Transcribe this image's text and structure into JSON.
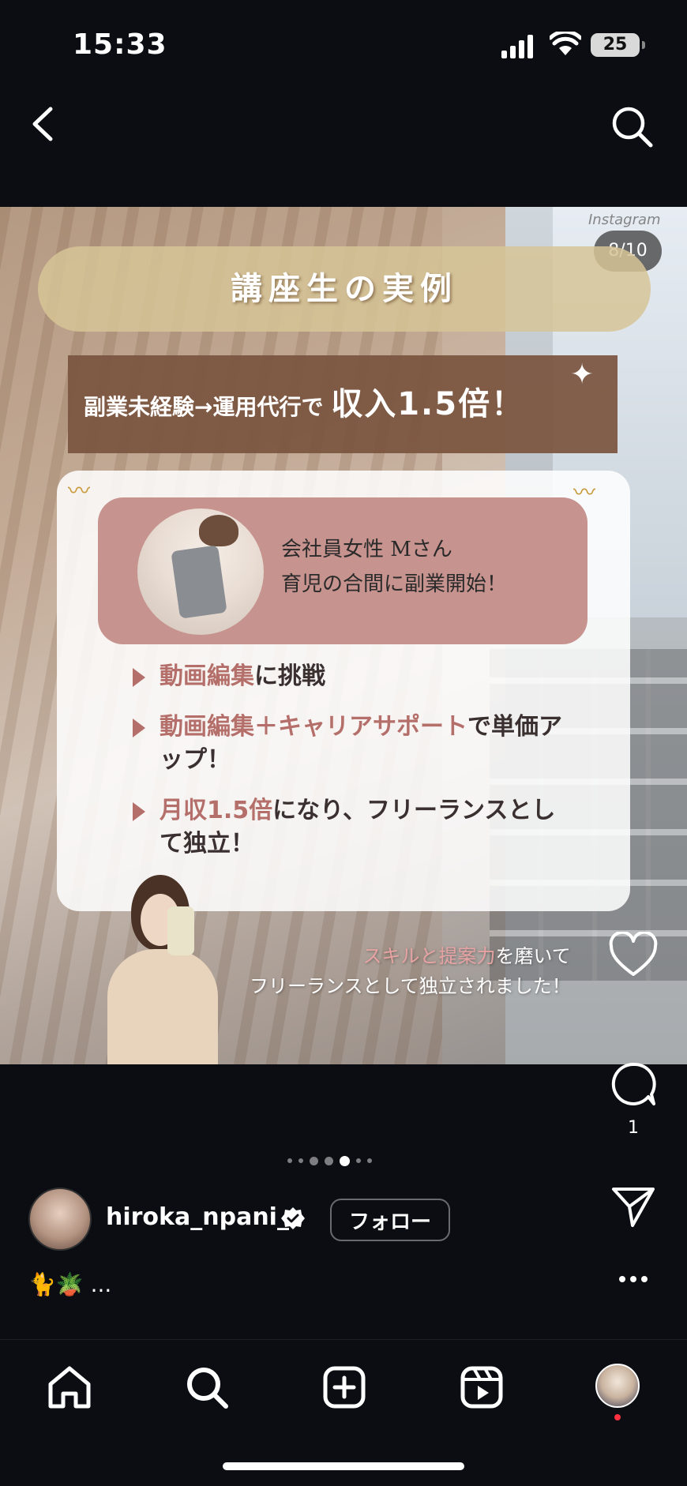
{
  "status_bar": {
    "time": "15:33",
    "battery": "25"
  },
  "header": {
    "back_icon": "chevron-left-icon",
    "search_icon": "search-icon"
  },
  "post": {
    "watermark": "Instagram",
    "counter": "8/10",
    "title": "講座生の実例",
    "subtitle_prefix": "副業未経験→運用代行で",
    "subtitle_emph": "収入1.5倍！",
    "profile_line1": "会社員女性 Mさん",
    "profile_line2": "育児の合間に副業開始！",
    "bullets": [
      {
        "hl": "動画編集",
        "rest": "に挑戦"
      },
      {
        "hl": "動画編集＋キャリアサポート",
        "rest": "で単価アップ！"
      },
      {
        "hl": "月収1.5倍",
        "rest": "になり、フリーランスとして独立！"
      }
    ],
    "script_line1_pink": "スキルと提案力",
    "script_line1_rest": "を磨いて",
    "script_line2": "フリーランスとして独立されました！"
  },
  "actions": {
    "like_icon": "heart-icon",
    "comment_icon": "comment-icon",
    "comment_count": "1",
    "share_icon": "send-icon",
    "more_icon": "more-icon"
  },
  "carousel": {
    "total_dots": 7,
    "active_index": 4
  },
  "user": {
    "username": "hiroka_npani_",
    "follow_label": "フォロー",
    "caption": "🐈🪴 ..."
  },
  "nav": {
    "items": [
      "home-icon",
      "search-icon",
      "create-icon",
      "reels-icon",
      "profile-avatar"
    ]
  },
  "colors": {
    "background": "#0b0d12",
    "accent_pink": "#b56f6a",
    "banner": "#7a543e"
  }
}
